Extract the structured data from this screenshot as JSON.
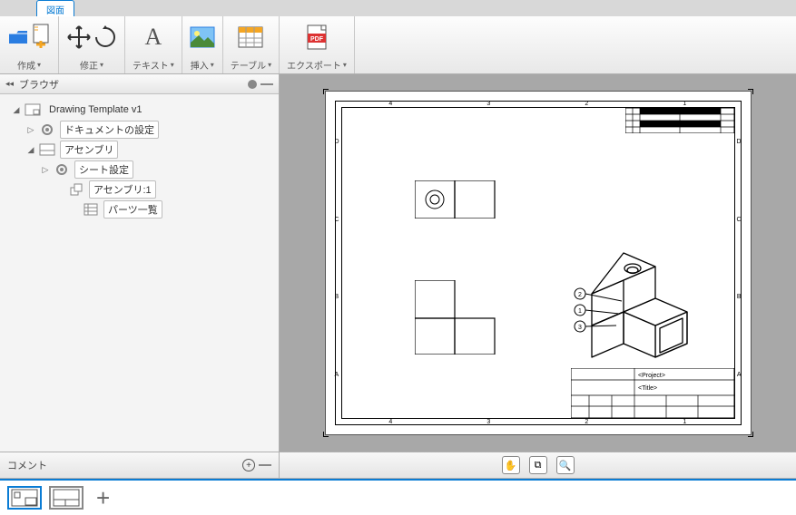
{
  "tab": {
    "label": "図面"
  },
  "ribbon": {
    "create": "作成",
    "modify": "修正",
    "text": "テキスト",
    "insert": "挿入",
    "table": "テーブル",
    "export": "エクスポート"
  },
  "browser": {
    "title": "ブラウザ",
    "root": "Drawing Template v1",
    "docSettings": "ドキュメントの設定",
    "assembly": "アセンブリ",
    "sheetSettings": "シート設定",
    "assembly1": "アセンブリ:1",
    "partsList": "パーツ一覧"
  },
  "comments": {
    "label": "コメント"
  },
  "drawing": {
    "cols": [
      "4",
      "3",
      "2",
      "1"
    ],
    "rows": [
      "D",
      "C",
      "B",
      "A"
    ],
    "titleblock": {
      "project": "<Project>",
      "title": "<Title>"
    },
    "balloons": [
      "2",
      "1",
      "3"
    ]
  }
}
